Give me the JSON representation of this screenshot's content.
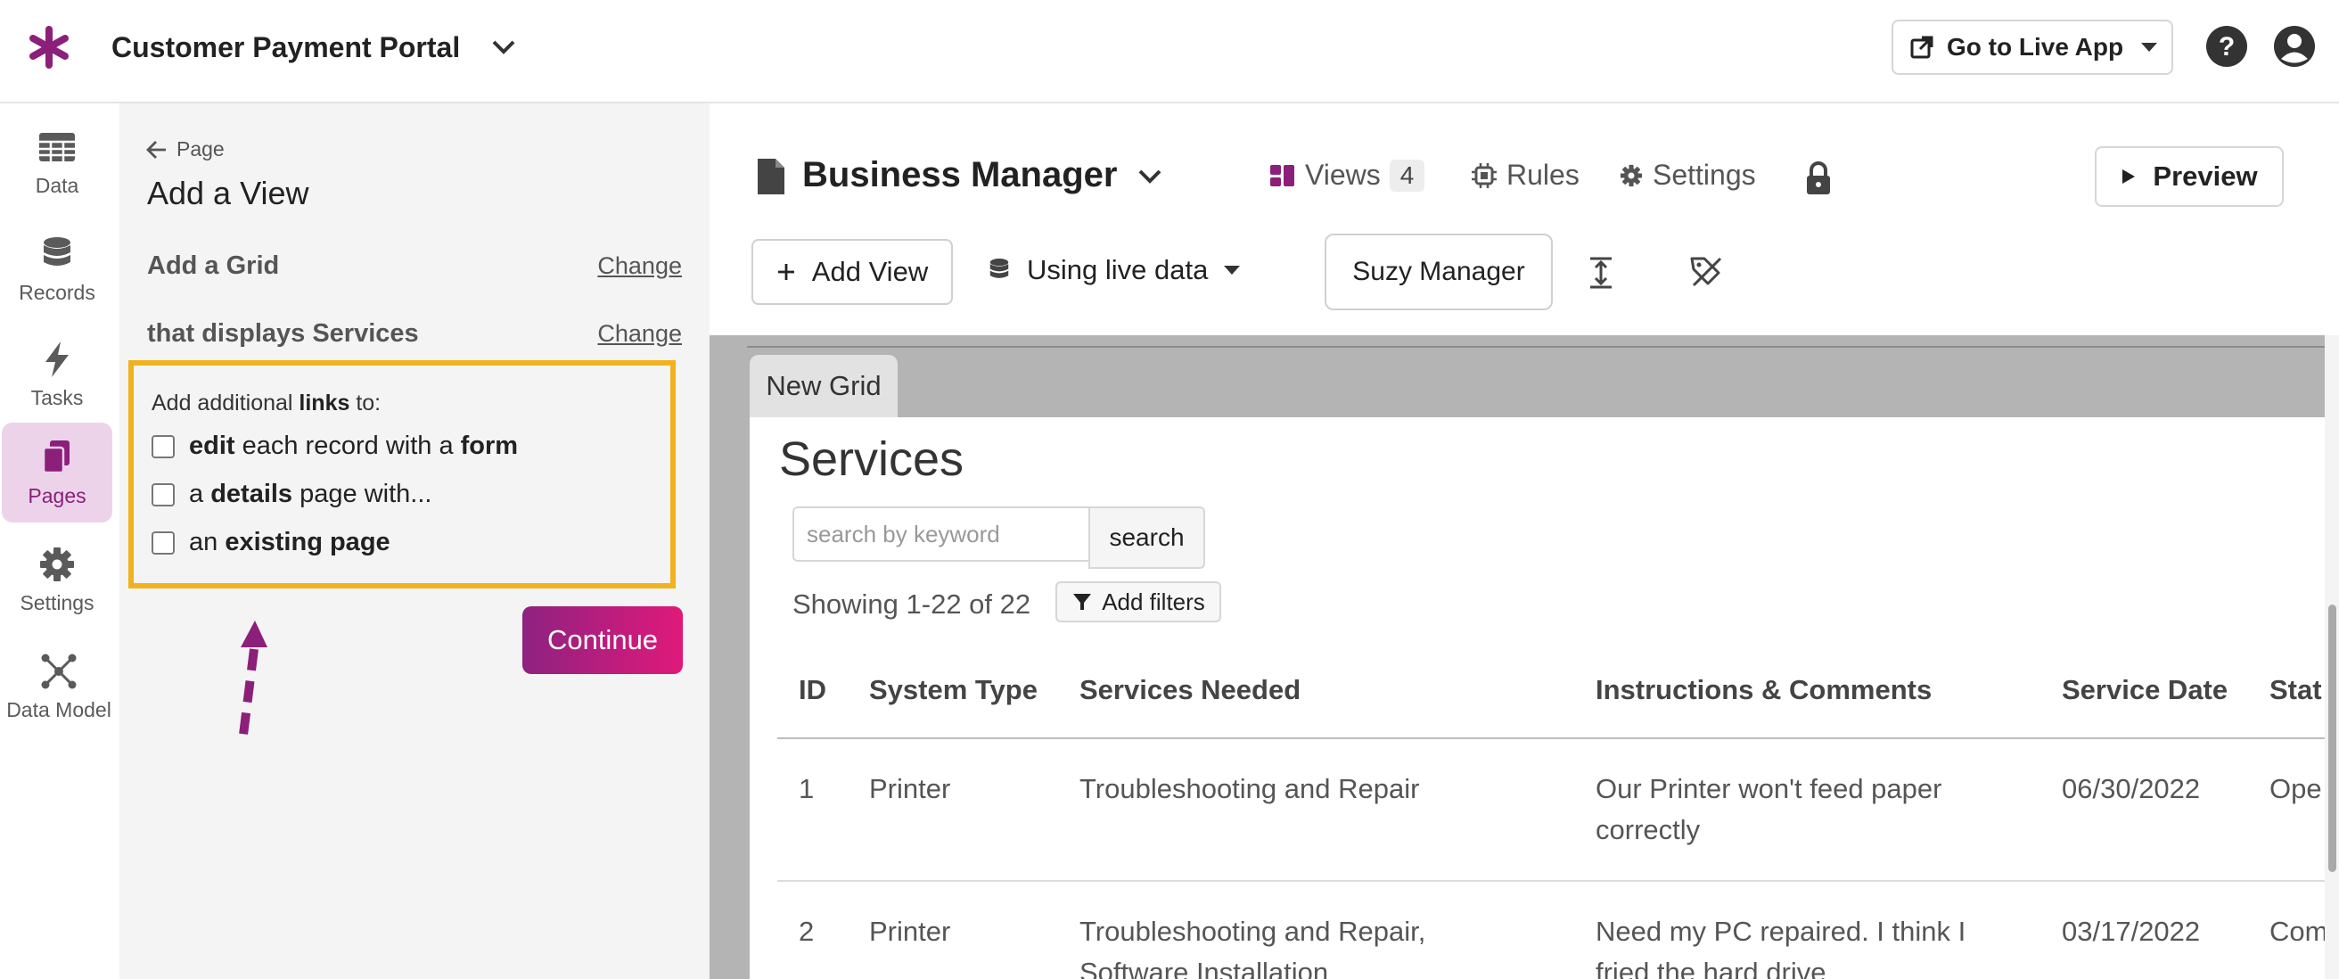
{
  "app": {
    "title": "Customer Payment Portal",
    "go_live_label": "Go to Live App",
    "accent": "#8b1f7a"
  },
  "nav": {
    "items": [
      {
        "label": "Data",
        "icon": "table-icon"
      },
      {
        "label": "Records",
        "icon": "database-icon"
      },
      {
        "label": "Tasks",
        "icon": "lightning-icon"
      },
      {
        "label": "Pages",
        "icon": "pages-icon",
        "active": true
      },
      {
        "label": "Settings",
        "icon": "gear-icon"
      },
      {
        "label": "Data Model",
        "icon": "graph-icon"
      }
    ]
  },
  "panel": {
    "back_label": "Page",
    "title": "Add a View",
    "step1": "Add a Grid",
    "step2": "that displays Services",
    "change_label": "Change",
    "links_title_pre": "Add additional ",
    "links_title_bold": "links",
    "links_title_post": " to:",
    "options": [
      {
        "b1": "edit",
        "t1": " each record with a ",
        "b2": "form"
      },
      {
        "t0": "a ",
        "b1": "details",
        "t1": " page with..."
      },
      {
        "t0": "an ",
        "b1": "existing page"
      }
    ],
    "continue_label": "Continue"
  },
  "header": {
    "page_title": "Business Manager",
    "views_label": "Views",
    "views_count": "4",
    "rules_label": "Rules",
    "settings_label": "Settings",
    "preview_label": "Preview",
    "add_view_label": "Add View",
    "live_data_label": "Using live data",
    "user_label": "Suzy Manager"
  },
  "grid": {
    "tab_label": "New Grid",
    "title": "Services",
    "search_placeholder": "search by keyword",
    "search_button": "search",
    "showing": "Showing 1-22 of 22",
    "add_filters": "Add filters",
    "columns": [
      "ID",
      "System Type",
      "Services Needed",
      "Instructions & Comments",
      "Service Date",
      "Stat"
    ],
    "rows": [
      {
        "id": "1",
        "system": "Printer",
        "services": [
          "Troubleshooting and Repair"
        ],
        "comments": [
          "Our Printer won't feed paper",
          "correctly"
        ],
        "date": "06/30/2022",
        "status": "Ope"
      },
      {
        "id": "2",
        "system": "Printer",
        "services": [
          "Troubleshooting and Repair,",
          "Software Installation"
        ],
        "comments": [
          "Need my PC repaired. I think I",
          "fried the hard drive"
        ],
        "date": "03/17/2022",
        "status": "Com"
      }
    ]
  }
}
